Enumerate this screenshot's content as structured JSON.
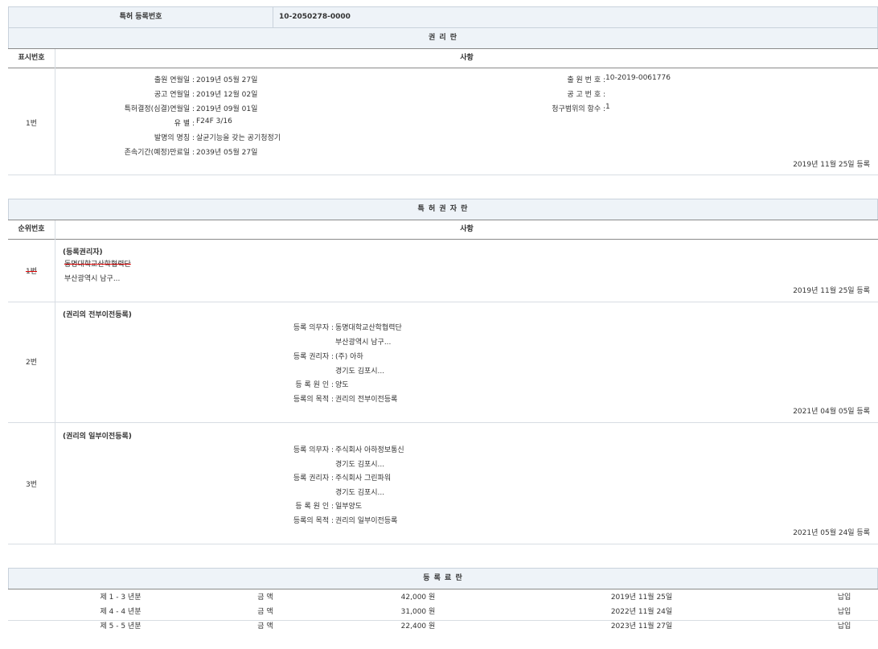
{
  "reg_number": {
    "label": "특허 등록번호",
    "value": "10-2050278-0000"
  },
  "rights": {
    "title": "권 리 란",
    "col_no": "표시번호",
    "col_item": "사항",
    "row_no": "1번",
    "left_fields": [
      {
        "label": "출원 연월일 :",
        "value": "2019년 05월 27일"
      },
      {
        "label": "공고 연월일 :",
        "value": "2019년 12월 02일"
      },
      {
        "label": "특허결정(심결)연월일 :",
        "value": "2019년 09월 01일"
      },
      {
        "label": "유 별 :",
        "value": "F24F 3/16"
      },
      {
        "label": "발명의 명칭 :",
        "value": "살균기능을 갖는 공기청정기"
      },
      {
        "label": "존속기간(예정)만료일 :",
        "value": "2039년 05월 27일"
      }
    ],
    "right_fields": [
      {
        "label": "출 원 번 호 :",
        "value": "10-2019-0061776"
      },
      {
        "label": "공 고 번 호 :",
        "value": ""
      },
      {
        "label": "청구범위의 항수 :",
        "value": "1"
      }
    ],
    "reg_date": "2019년 11월 25일 등록"
  },
  "holders": {
    "title": "특 허 권 자 란",
    "col_no": "순위번호",
    "col_item": "사항",
    "rows": [
      {
        "no": "1번",
        "heading": "(등록권리자)",
        "name": "동명대학교산학협력단",
        "address": "부산광역시 남구...",
        "date": "2019년 11월 25일 등록"
      },
      {
        "no": "2번",
        "heading": "(권리의 전부이전등록)",
        "fields": [
          {
            "label": "등록 의무자 :",
            "value": "동명대학교산학협력단"
          },
          {
            "label": "",
            "value": "부산광역시 남구..."
          },
          {
            "label": "등록 권리자 :",
            "value": "(주) 아하"
          },
          {
            "label": "",
            "value": "경기도 김포시..."
          },
          {
            "label": "등 록 원 인 :",
            "value": "양도"
          },
          {
            "label": "등록의 목적 :",
            "value": "권리의 전부이전등록"
          }
        ],
        "date": "2021년 04월 05일 등록"
      },
      {
        "no": "3번",
        "heading": "(권리의 일부이전등록)",
        "fields": [
          {
            "label": "등록 의무자 :",
            "value": "주식회사 아하정보통신"
          },
          {
            "label": "",
            "value": "경기도 김포시..."
          },
          {
            "label": "등록 권리자 :",
            "value": "주식회사 그린파워"
          },
          {
            "label": "",
            "value": "경기도 김포시..."
          },
          {
            "label": "등 록 원 인 :",
            "value": "일부양도"
          },
          {
            "label": "등록의 목적 :",
            "value": "권리의 일부이전등록"
          }
        ],
        "date": "2021년 05월 24일 등록"
      }
    ]
  },
  "fees": {
    "title": "등 록 료 란",
    "rows": [
      {
        "period": "제 1 - 3 년분",
        "label": "금 액",
        "amount": "42,000 원",
        "date": "2019년 11월 25일",
        "status": "납입"
      },
      {
        "period": "제 4 - 4 년분",
        "label": "금 액",
        "amount": "31,000 원",
        "date": "2022년 11월 24일",
        "status": "납입"
      },
      {
        "period": "제 5 - 5 년분",
        "label": "금 액",
        "amount": "22,400 원",
        "date": "2023년 11월 27일",
        "status": "납입"
      }
    ]
  }
}
